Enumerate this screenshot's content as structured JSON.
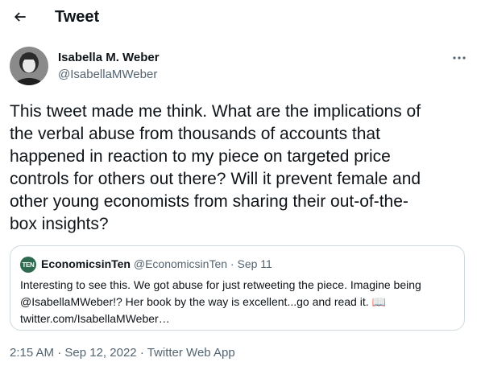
{
  "header": {
    "title": "Tweet",
    "back_icon": "arrow-left-icon"
  },
  "author": {
    "name": "Isabella M. Weber",
    "handle": "@IsabellaMWeber"
  },
  "tweet": {
    "lines": [
      "This tweet made me think. What are the implications of",
      "the verbal abuse from thousands of accounts that",
      "happened in reaction to my piece on targeted price",
      "controls for others out there? Will it prevent female and",
      "other young economists from sharing their out-of-the-",
      "box insights?"
    ]
  },
  "quote": {
    "avatar_text": "TEN",
    "name": "EconomicsinTen",
    "handle": "@EconomicsinTen",
    "separator": "·",
    "date": "Sep 11",
    "lines": [
      "Interesting to see this. We got abuse for just retweeting the piece. Imagine being",
      "@IsabellaMWeber!? Her book by the way is excellent...go and read it. 📖",
      "twitter.com/IsabellaMWeber…"
    ]
  },
  "meta": {
    "time": "2:15 AM",
    "separator": "·",
    "date": "Sep 12, 2022",
    "source": "Twitter Web App"
  },
  "colors": {
    "text": "#0f1419",
    "secondary": "#536471",
    "border": "#cfd9de"
  }
}
